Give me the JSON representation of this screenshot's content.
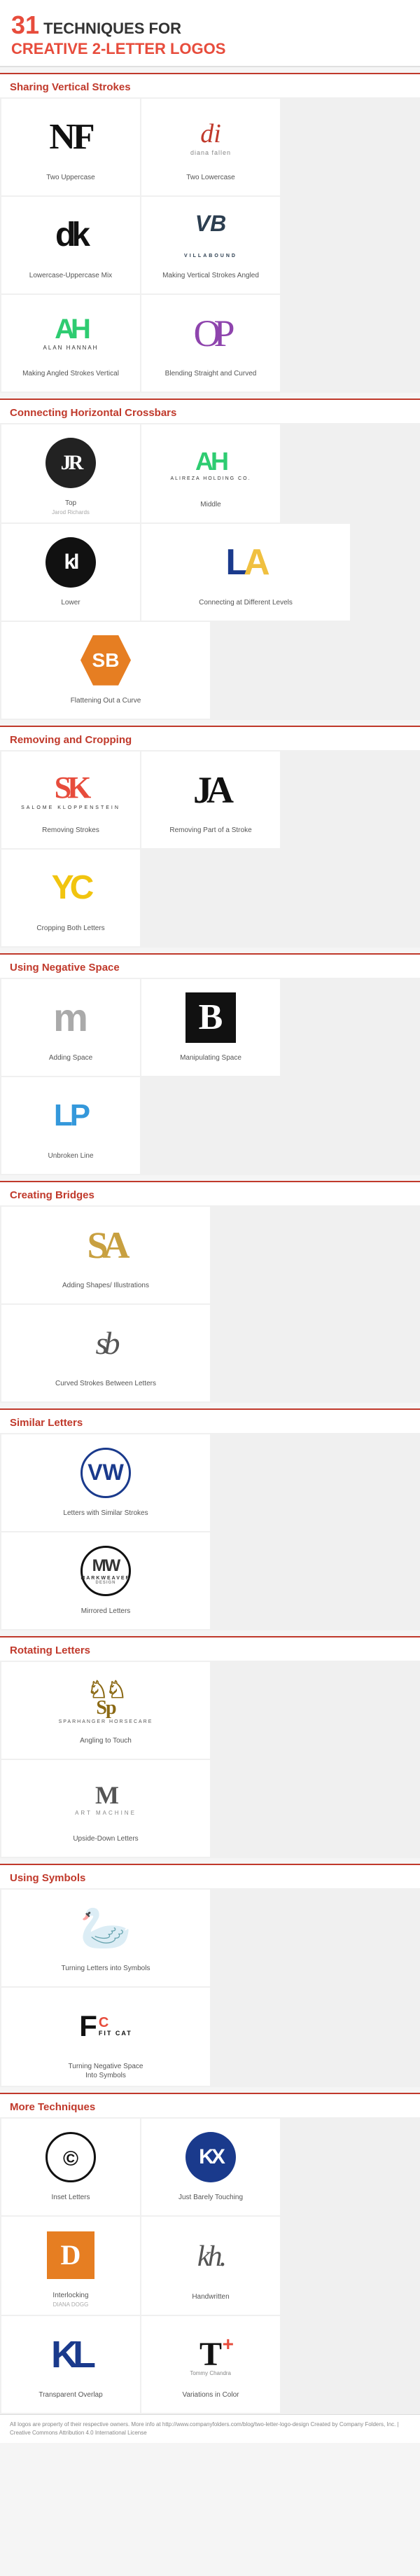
{
  "header": {
    "number": "31",
    "line1": "TECHNIQUES FOR",
    "line2": "CREATIVE 2-LETTER LOGOS"
  },
  "sections": [
    {
      "id": "sharing-vertical-strokes",
      "title": "Sharing Vertical Strokes",
      "logos": [
        {
          "id": "nf",
          "label": "Two Uppercase"
        },
        {
          "id": "diana",
          "label": "Two Lowercase"
        },
        {
          "id": "dk",
          "label": "Lowercase-Uppercase Mix"
        },
        {
          "id": "vb",
          "label": "Making Vertical Strokes Angled"
        },
        {
          "id": "ah",
          "label": "Making Angled Strokes Vertical"
        },
        {
          "id": "op",
          "label": "Blending Straight and Curved"
        }
      ]
    },
    {
      "id": "connecting-horizontal-crossbars",
      "title": "Connecting Horizontal Crossbars",
      "logos": [
        {
          "id": "jr",
          "label": "Top"
        },
        {
          "id": "ah-holding",
          "label": "Middle"
        },
        {
          "id": "kl-circle",
          "label": "Lower"
        },
        {
          "id": "la",
          "label": "Connecting at Different Levels"
        },
        {
          "id": "sb-hex",
          "label": "Flattening Out a Curve"
        }
      ]
    },
    {
      "id": "removing-cropping",
      "title": "Removing and Cropping",
      "logos": [
        {
          "id": "sk",
          "label": "Removing Strokes"
        },
        {
          "id": "ja",
          "label": "Removing Part of a Stroke"
        },
        {
          "id": "yc",
          "label": "Cropping Both Letters"
        }
      ]
    },
    {
      "id": "using-negative-space",
      "title": "Using Negative Space",
      "logos": [
        {
          "id": "m-neg",
          "label": "Adding Space"
        },
        {
          "id": "b-black",
          "label": "Manipulating Space"
        },
        {
          "id": "lp",
          "label": "Unbroken Line"
        }
      ]
    },
    {
      "id": "creating-bridges",
      "title": "Creating Bridges",
      "logos": [
        {
          "id": "sa",
          "label": "Adding Shapes/ Illustrations"
        },
        {
          "id": "sb-script",
          "label": "Curved Strokes Between Letters"
        }
      ]
    },
    {
      "id": "similar-letters",
      "title": "Similar Letters",
      "logos": [
        {
          "id": "vw",
          "label": "Letters with Similar Strokes"
        },
        {
          "id": "mw",
          "label": "Mirrored Letters"
        }
      ]
    },
    {
      "id": "rotating-letters",
      "title": "Rotating Letters",
      "logos": [
        {
          "id": "sh",
          "label": "Angling to Touch"
        },
        {
          "id": "am",
          "label": "Upside-Down Letters"
        }
      ]
    },
    {
      "id": "using-symbols",
      "title": "Using Symbols",
      "logos": [
        {
          "id": "swan",
          "label": "Turning Letters into Symbols"
        },
        {
          "id": "fitcat",
          "label": "Turning Negative Space\nInto Symbols"
        }
      ]
    },
    {
      "id": "more-techniques",
      "title": "More Techniques",
      "logos": [
        {
          "id": "cc",
          "label": "Inset Letters"
        },
        {
          "id": "kx",
          "label": "Just Barely Touching"
        },
        {
          "id": "diana-dogg",
          "label": "Interlocking"
        },
        {
          "id": "kh",
          "label": "Handwritten"
        },
        {
          "id": "kl-big",
          "label": "Transparent Overlap"
        },
        {
          "id": "cross",
          "label": "Variations in Color"
        }
      ]
    }
  ],
  "footer": {
    "text": "All logos are property of their respective owners. More info at http://www.companyfolders.com/blog/two-letter-logo-design Created by Company Folders, Inc. | Creative Commons Attribution 4.0 International License"
  },
  "labels": {
    "two_uppercase": "Two Uppercase",
    "two_lowercase": "Two Lowercase",
    "lowercase_uppercase": "Lowercase-Uppercase Mix",
    "angled": "Making Vertical Strokes Angled",
    "angled_vertical": "Making Angled Strokes Vertical",
    "straight_curved": "Blending Straight and Curved",
    "top": "Top",
    "middle": "Middle",
    "lower": "Lower",
    "diff_levels": "Connecting at Different Levels",
    "flatten_curve": "Flattening Out a Curve",
    "removing_strokes": "Removing Strokes",
    "removing_part": "Removing Part of a Stroke",
    "cropping_both": "Cropping Both Letters",
    "adding_space": "Adding Space",
    "manipulating_space": "Manipulating Space",
    "unbroken_line": "Unbroken Line",
    "adding_shapes": "Adding Shapes/ Illustrations",
    "curved_strokes": "Curved Strokes Between Letters",
    "similar_strokes": "Letters with Similar Strokes",
    "mirrored": "Mirrored Letters",
    "angling_touch": "Angling to Touch",
    "upside_down": "Upside-Down Letters",
    "turning_symbols": "Turning Letters into Symbols",
    "turning_neg": "Turning Negative Space\nInto Symbols",
    "inset": "Inset Letters",
    "barely": "Just Barely Touching",
    "interlocking": "Interlocking",
    "handwritten": "Handwritten",
    "transparent": "Transparent Overlap",
    "variations": "Variations in Color"
  }
}
